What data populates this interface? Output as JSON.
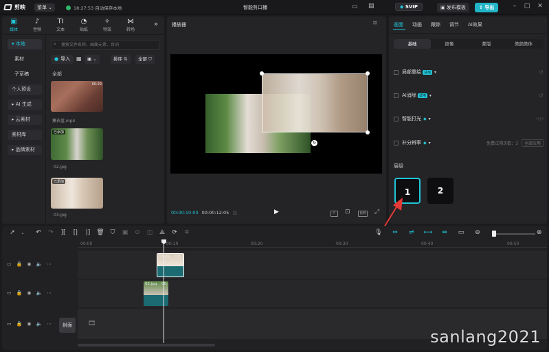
{
  "app": {
    "name": "剪映",
    "menu_label": "菜单",
    "save_status": "18:27:53 自动保存本地",
    "window_title": "智能剪口播"
  },
  "header": {
    "svip_label": "SVIP",
    "template_label": "发布模板",
    "export_label": "导出"
  },
  "media_tabs": [
    {
      "label": "媒体",
      "icon": "media-icon",
      "glyph": "▣"
    },
    {
      "label": "音频",
      "icon": "audio-icon",
      "glyph": "♪"
    },
    {
      "label": "文本",
      "icon": "text-icon",
      "glyph": "TI"
    },
    {
      "label": "贴纸",
      "icon": "sticker-icon",
      "glyph": "◔"
    },
    {
      "label": "特效",
      "icon": "effects-icon",
      "glyph": "✧"
    },
    {
      "label": "转场",
      "icon": "transition-icon",
      "glyph": "⋈"
    }
  ],
  "left_nav": [
    {
      "label": "▾ 本地",
      "type": "active"
    },
    {
      "label": "素材",
      "type": "sub"
    },
    {
      "label": "子草稿",
      "type": "sub"
    },
    {
      "label": "个人预设",
      "type": "normal"
    },
    {
      "label": "▸ AI 生成",
      "type": "normal"
    },
    {
      "label": "▸ 云素材",
      "type": "normal"
    },
    {
      "label": "素材库",
      "type": "normal"
    },
    {
      "label": "▸ 品牌素材",
      "type": "normal"
    }
  ],
  "media": {
    "search_placeholder": "搜索文件名称、画面元素、台词",
    "import_label": "导入",
    "sort_label": "排序",
    "filter_label": "全部",
    "section_label": "全部",
    "items": [
      {
        "name": "薰衣蓝.mp4",
        "duration": "00:29",
        "tag": ""
      },
      {
        "name": "02.jpg",
        "duration": "",
        "tag": "已添加"
      },
      {
        "name": "03.jpg",
        "duration": "",
        "tag": "已添加"
      }
    ]
  },
  "player": {
    "title": "播放器",
    "current_time": "00:00:10:00",
    "total_time": "00:00:12:05",
    "ratio_label": "比例"
  },
  "right_panel": {
    "tabs": [
      "画面",
      "动画",
      "跟踪",
      "调节",
      "AI效果"
    ],
    "subtabs": [
      "基础",
      "抠像",
      "蒙版",
      "美颜美体"
    ],
    "props": [
      {
        "label": "局部重绘",
        "badge": "试用"
      },
      {
        "label": "AI消除",
        "badge": "试用"
      },
      {
        "label": "智能打光",
        "badge": ""
      },
      {
        "label": "补分辨率",
        "badge": ""
      }
    ],
    "free_trial_text": "免费试用次数：3",
    "apply_all_label": "全部应用",
    "layer_section_label": "层级",
    "layer_buttons": [
      "1",
      "2"
    ]
  },
  "timeline": {
    "ruler_labels": [
      "00:00",
      "00:10",
      "00:20",
      "00:30",
      "00:40",
      "00:50"
    ],
    "clips": [
      {
        "label": "03.jpg",
        "duration": "00:"
      },
      {
        "label": "02.jpg",
        "duration": "00:"
      }
    ],
    "cover_label": "封面"
  },
  "watermark": "sanlang2021",
  "colors": {
    "accent": "#21c6d8",
    "panel": "#242427",
    "background": "#1b1b1d",
    "arrow": "#e53935"
  }
}
